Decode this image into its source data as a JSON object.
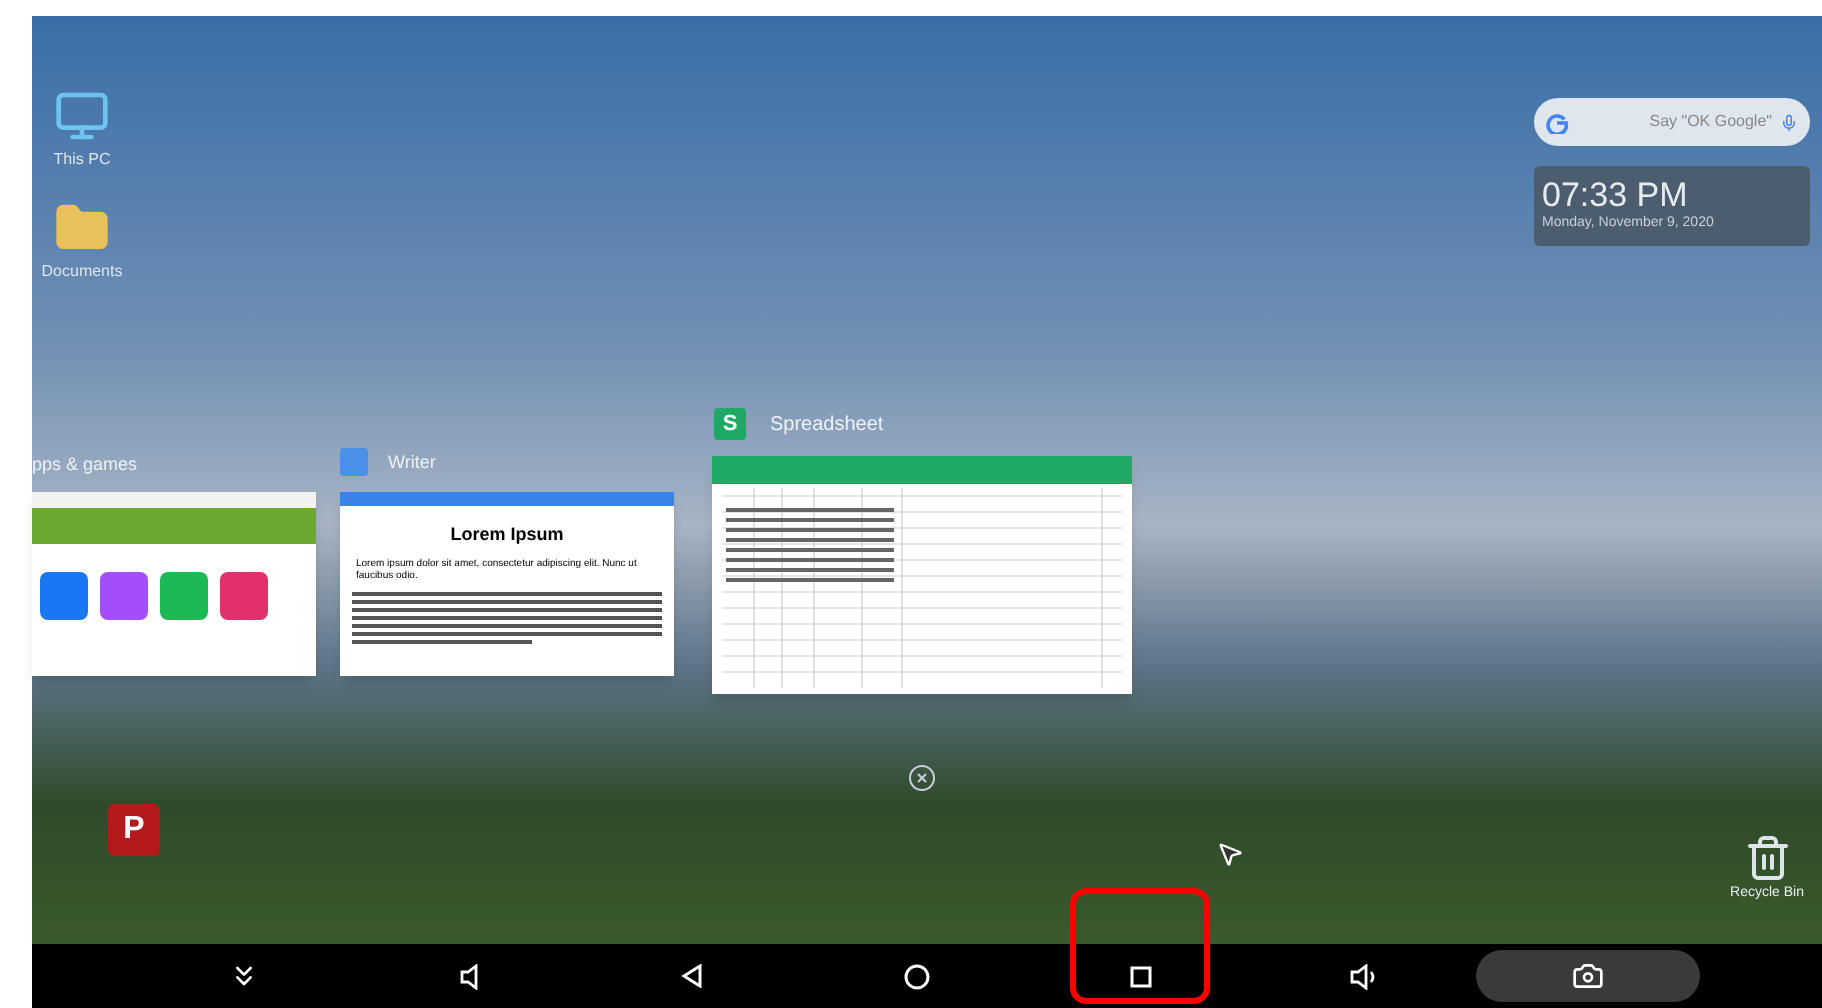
{
  "desktop_icons": [
    {
      "kind": "computer",
      "label": "This PC"
    },
    {
      "kind": "folder",
      "label": "Documents"
    }
  ],
  "search_widget": {
    "placeholder": "Say \"OK Google\""
  },
  "clock_widget": {
    "time": "07:33 PM",
    "date": "Monday, November 9, 2020"
  },
  "recent_apps": [
    {
      "kind": "store",
      "label": "pps & games"
    },
    {
      "kind": "writer",
      "label": "Writer",
      "heading": "Lorem Ipsum",
      "body": "Lorem ipsum dolor sit amet, consectetur adipiscing elit. Nunc ut faucibus odio."
    },
    {
      "kind": "sheet",
      "label": "Spreadsheet",
      "icon_letter": "S"
    }
  ],
  "pinned_app": {
    "letter": "P"
  },
  "recycle_bin": {
    "label": "Recycle Bin"
  },
  "nav_bar": [
    {
      "kind": "collapse",
      "highlighted": false
    },
    {
      "kind": "volume_down",
      "highlighted": false
    },
    {
      "kind": "back",
      "highlighted": false
    },
    {
      "kind": "home",
      "highlighted": false
    },
    {
      "kind": "recents",
      "highlighted": true
    },
    {
      "kind": "volume_up",
      "highlighted": false
    },
    {
      "kind": "screenshot",
      "highlighted": false
    }
  ]
}
